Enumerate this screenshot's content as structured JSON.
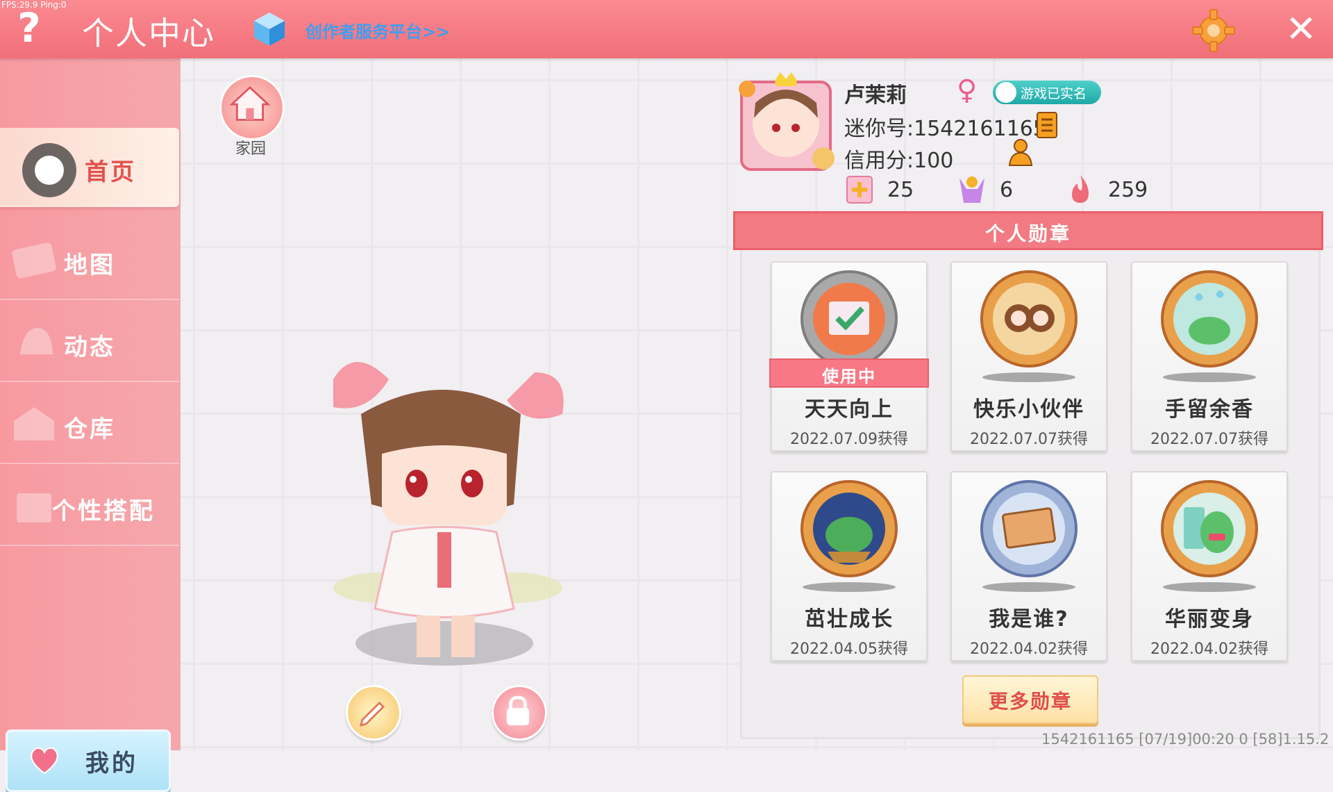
{
  "debug": {
    "fps": "FPS:29.9 Ping:0"
  },
  "header": {
    "title": "个人中心",
    "creator_link": "创作者服务平台>>"
  },
  "sidebar": {
    "items": [
      {
        "label": "首页",
        "active": true
      },
      {
        "label": "地图"
      },
      {
        "label": "动态"
      },
      {
        "label": "仓库"
      },
      {
        "label": "个性搭配"
      }
    ],
    "mine_button": "我的"
  },
  "home": {
    "label": "家园"
  },
  "profile": {
    "name": "卢茉莉",
    "realname_badge": "游戏已实名",
    "mini_id": "迷你号:1542161165",
    "credit": "信用分:100",
    "stats": {
      "likes": "25",
      "fans": "6",
      "popularity": "259"
    }
  },
  "badges": {
    "header": "个人勋章",
    "in_use_label": "使用中",
    "items": [
      {
        "name": "天天向上",
        "date": "2022.07.09获得",
        "in_use": true
      },
      {
        "name": "快乐小伙伴",
        "date": "2022.07.07获得"
      },
      {
        "name": "手留余香",
        "date": "2022.07.07获得"
      },
      {
        "name": "茁壮成长",
        "date": "2022.04.05获得"
      },
      {
        "name": "我是谁?",
        "date": "2022.04.02获得"
      },
      {
        "name": "华丽变身",
        "date": "2022.04.02获得"
      }
    ],
    "more_button": "更多勋章"
  },
  "footer": {
    "info": "1542161165   [07/19]00:20 0   [58]1.15.2"
  },
  "colors": {
    "topbar": "#f16f79",
    "sidebar": "#f79aa0",
    "accent": "#e2514b",
    "link": "#3f9ef2"
  }
}
